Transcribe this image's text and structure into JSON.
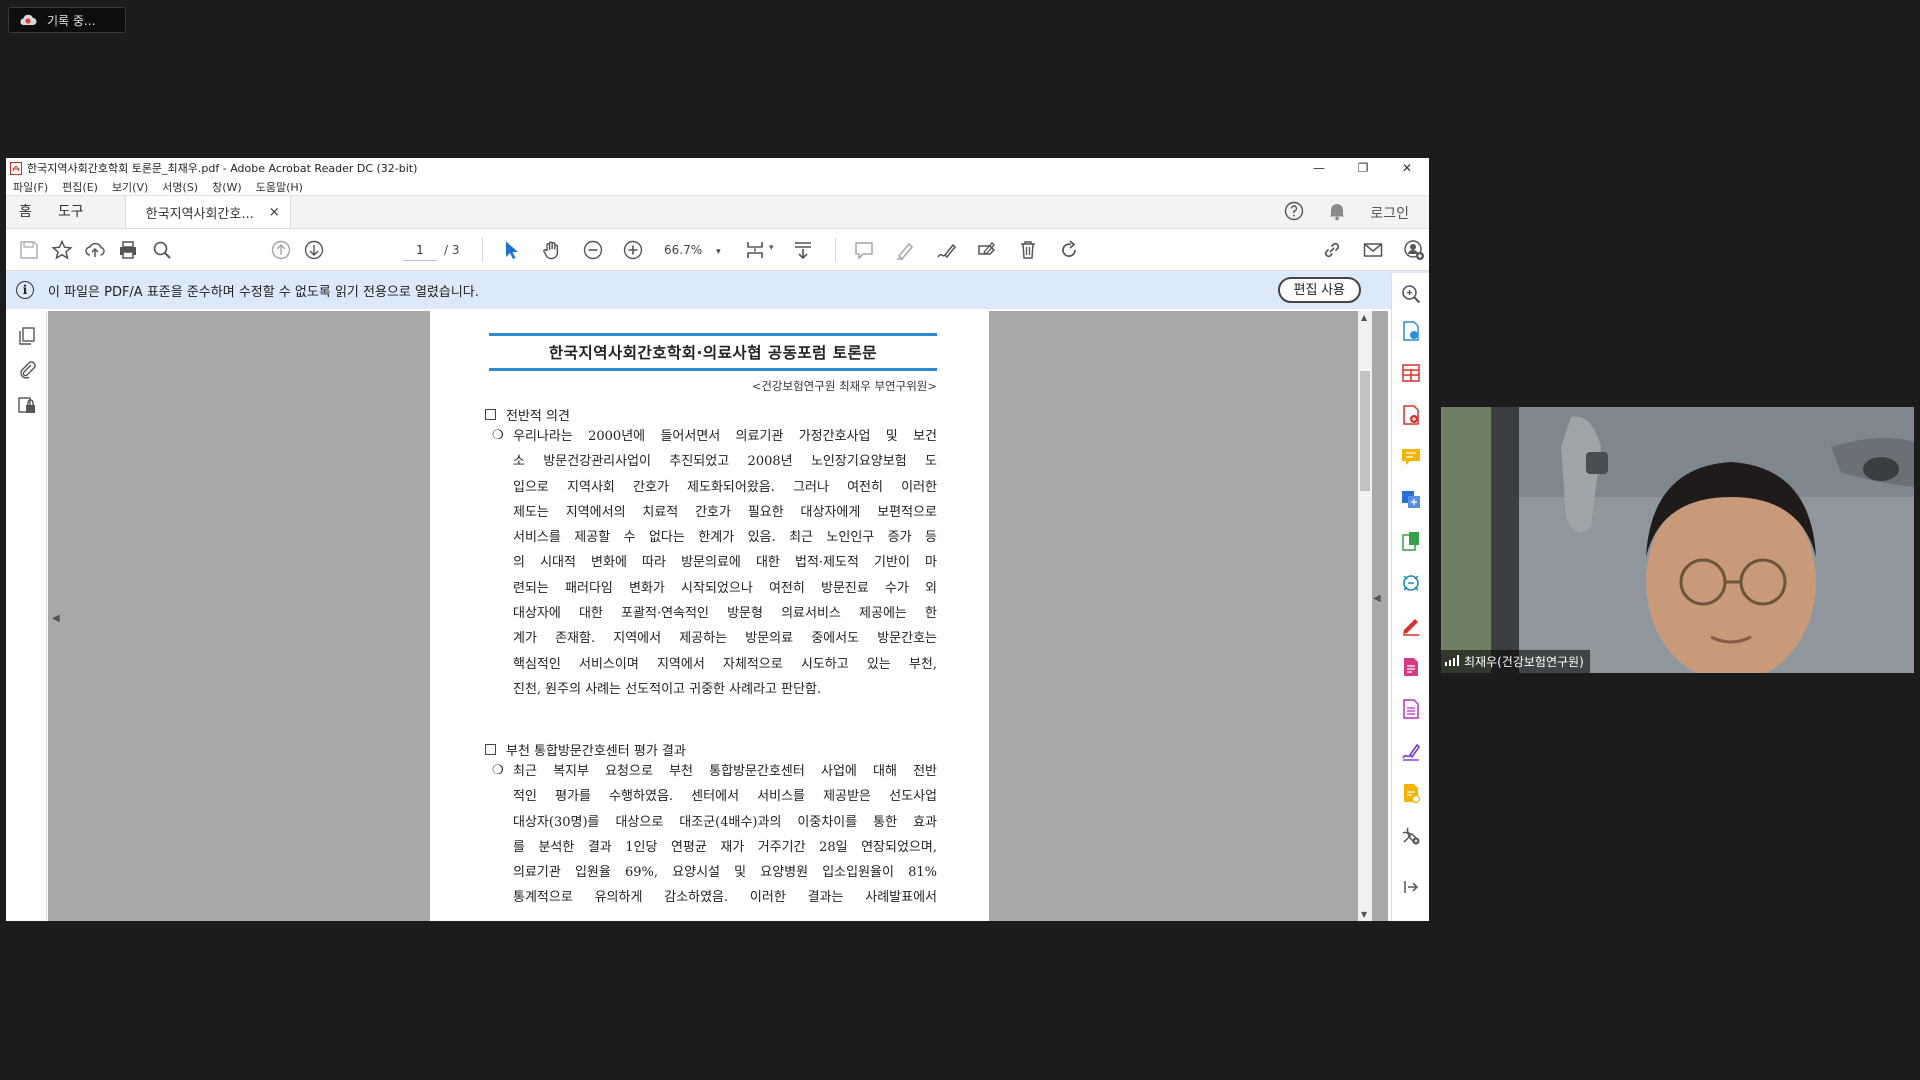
{
  "recording": {
    "label": "기록 중..."
  },
  "window": {
    "title": "한국지역사회간호학회 토론문_최재우.pdf - Adobe Acrobat Reader DC (32-bit)",
    "controls": [
      "—",
      "❐",
      "✕"
    ]
  },
  "menu": [
    "파일(F)",
    "편집(E)",
    "보기(V)",
    "서명(S)",
    "창(W)",
    "도움말(H)"
  ],
  "tabs": {
    "home": "홈",
    "tools": "도구",
    "document": "한국지역사회간호...",
    "close": "×",
    "signin": "로그인"
  },
  "toolbar": {
    "page_current": "1",
    "page_total": "/ 3",
    "zoom": "66.7%"
  },
  "infobar": {
    "message": "이 파일은 PDF/A 표준을 준수하며 수정할 수 없도록 읽기 전용으로 열렸습니다.",
    "edit_button": "편집 사용"
  },
  "document": {
    "title": "한국지역사회간호학회·의료사협 공동포럼 토론문",
    "byline": "<건강보험연구원 최재우 부연구위원>",
    "section1": {
      "heading": "전반적 의견",
      "lines": [
        "우리나라는 2000년에 들어서면서 의료기관 가정간호사업 및 보건",
        "소 방문건강관리사업이 추진되었고 2008년 노인장기요양보험 도",
        "입으로 지역사회 간호가 제도화되어왔음. 그러나 여전히 이러한",
        "제도는 지역에서의 치료적 간호가 필요한 대상자에게 보편적으로",
        "서비스를 제공할 수 없다는 한계가 있음. 최근 노인인구 증가 등",
        "의 시대적 변화에 따라 방문의료에 대한 법적·제도적 기반이 마",
        "련되는 패러다임 변화가 시작되었으나 여전히 방문진료 수가 외",
        "대상자에 대한 포괄적·연속적인 방문형 의료서비스 제공에는 한",
        "계가 존재함. 지역에서 제공하는 방문의료 중에서도 방문간호는",
        "핵심적인 서비스이며 지역에서 자체적으로 시도하고 있는 부천,",
        "진천, 원주의 사례는 선도적이고 귀중한 사례라고 판단함."
      ]
    },
    "section2": {
      "heading": "부천 통합방문간호센터 평가 결과",
      "lines": [
        "최근 복지부 요청으로 부천 통합방문간호센터 사업에 대해 전반",
        "적인 평가를 수행하였음. 센터에서 서비스를 제공받은 선도사업",
        "대상자(30명)를 대상으로 대조군(4배수)과의 이중차이를 통한 효과",
        "를 분석한 결과 1인당 연평균 재가 거주기간 28일 연장되었으며,",
        "의료기관 입원율 69%, 요양시설 및 요양병원 입소입원율이 81%",
        "통계적으로 유의하게 감소하였음. 이러한 결과는 사례발표에서"
      ]
    }
  },
  "participant": {
    "name": "최재우(건강보험연구원)"
  }
}
